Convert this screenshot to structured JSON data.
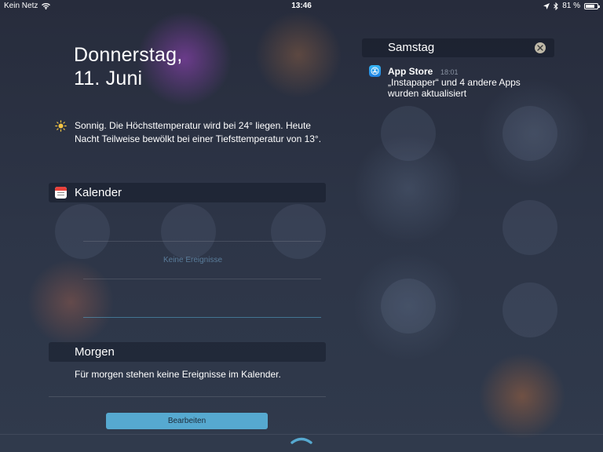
{
  "status_bar": {
    "carrier": "Kein Netz",
    "time": "13:46",
    "battery": "81 %",
    "battery_level": 0.81
  },
  "today": {
    "date_line1": "Donnerstag,",
    "date_line2": "11. Juni",
    "weather_icon": "sun-icon",
    "weather_text": "Sonnig. Die Höchsttemperatur wird bei 24° liegen. Heute Nacht Teilweise bewölkt bei einer Tiefsttemperatur von 13°."
  },
  "calendar": {
    "title": "Kalender",
    "empty_text": "Keine Ereignisse"
  },
  "tomorrow": {
    "title": "Morgen",
    "text": "Für morgen stehen keine Ereignisse im Kalender."
  },
  "edit_button": {
    "label": "Bearbeiten"
  },
  "notifications_day": {
    "title": "Samstag"
  },
  "notification": {
    "app": "App Store",
    "time": "18:01",
    "body": "„Instapaper“ und 4 andere Apps wurden aktualisiert"
  },
  "colors": {
    "accent": "#56a9d0",
    "empty_text": "#5a7c9a"
  }
}
